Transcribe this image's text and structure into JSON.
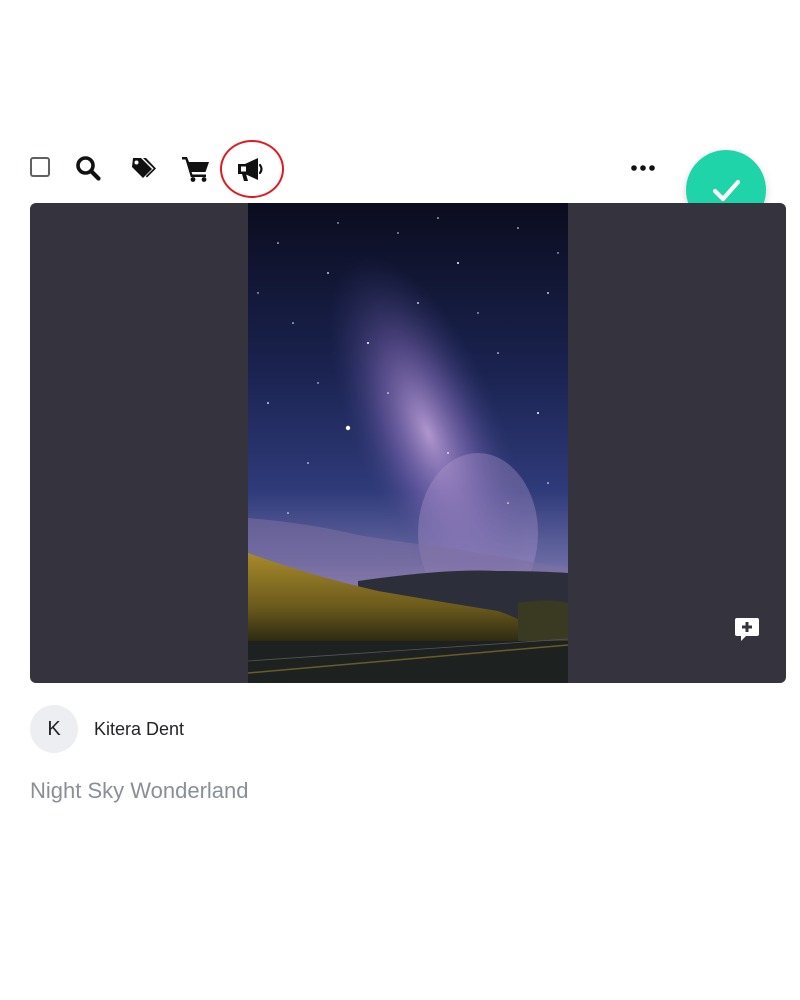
{
  "toolbar": {
    "icons": [
      "checkbox",
      "search-icon",
      "tags-icon",
      "cart-icon",
      "megaphone-icon",
      "more-icon"
    ],
    "highlighted_icon": "megaphone-icon"
  },
  "fab": {
    "icon": "checkmark-icon",
    "color": "#1fd4a8"
  },
  "post": {
    "author_initial": "K",
    "author_name": "Kitera Dent",
    "title": "Night Sky Wonderland"
  },
  "colors": {
    "media_background": "#35343e",
    "highlight_ring": "#e3191f"
  }
}
